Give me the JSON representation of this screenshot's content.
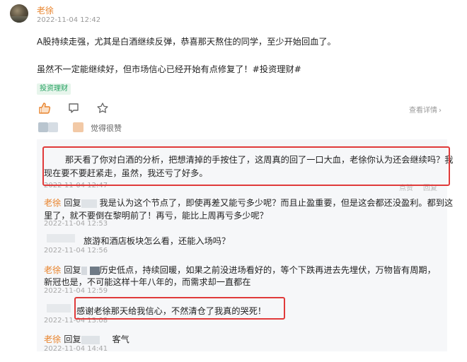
{
  "post": {
    "author": "老徐",
    "time": "2022-11-04 12:42",
    "para1": "A股持续走强，尤其是白酒继续反弹，恭喜那天熬住的同学，至少开始回血了。",
    "para2": "虽然不一定能继续好，但市场信心已经开始有点修复了！#投资理财#",
    "tag": "投资理财",
    "view_detail": "查看详情",
    "liked_text": "觉得很赞",
    "icons": [
      "thumbs-up-icon",
      "comment-icon",
      "star-icon",
      "chevron-right-icon"
    ]
  },
  "thread": {
    "q1_line1": "那天看了你对白酒的分析，把想清掉的手按住了，这周真的回了一口大血，老徐你认为还会继续吗？我",
    "q1_line2": "现在要不要赶紧走，虽然，我还亏了好多。",
    "q1_time": "2022-11-04 12:47",
    "q1_actions": [
      "点赞",
      "回复"
    ],
    "r1_name": "老徐",
    "r1_reply_prefix": "回复",
    "r1_line1": "我是认为这个节点了，即使再差又能亏多少呢？而且止盈重要，但是这会都还没盈利。都到这",
    "r1_line2": "里了，就不要倒在黎明前了！再亏，能比上周再亏多少呢？",
    "r1_time": "2022-11-04 12:53",
    "q2_text": "旅游和酒店板块怎么看，还能入场吗？",
    "q2_time": "2022-11-04 12:56",
    "r2_name": "老徐",
    "r2_reply_prefix": "回复",
    "r2_line1": "历史低点，持续回暖，如果之前没进场看好的，等个下跌再进去先埋伏，万物皆有周期，",
    "r2_line2": "新冠也是，不可能这样十年八年的，而需求却一直都在",
    "r2_time": "2022-11-04 12:59",
    "q3_text": "感谢老徐那天给我信心，不然清仓了我真的哭死！",
    "q3_time": "2022-11-04 13:08",
    "r3_name": "老徐",
    "r3_reply_prefix": "回复",
    "r3_text": "客气",
    "r3_time": "2022-11-04 14:41"
  },
  "colors": {
    "accent_orange": "#e8842d",
    "tag_green": "#23a15f",
    "highlight_red": "#e03a3a"
  }
}
